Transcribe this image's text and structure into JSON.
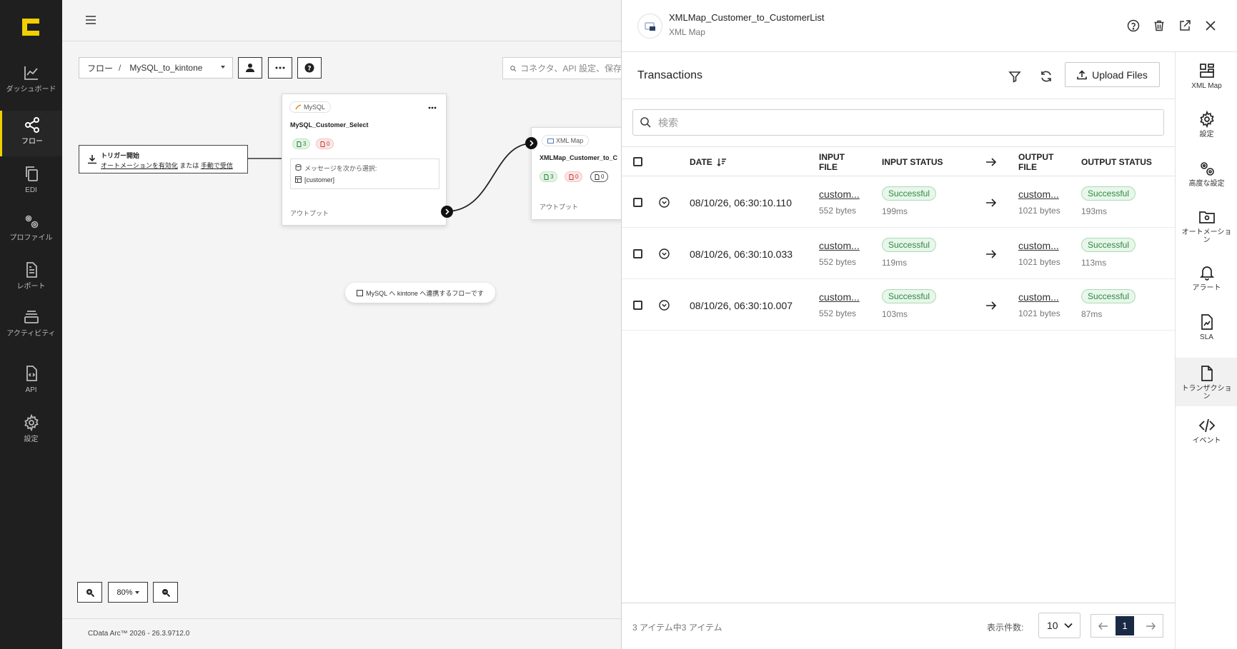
{
  "nav": {
    "items": [
      {
        "label": "ダッシュボード",
        "icon": "chart-line-icon"
      },
      {
        "label": "フロー",
        "icon": "share-nodes-icon",
        "active": true
      },
      {
        "label": "EDI",
        "icon": "copy-icon"
      },
      {
        "label": "プロファイル",
        "icon": "gears-icon"
      },
      {
        "label": "レポート",
        "icon": "file-text-icon"
      },
      {
        "label": "アクティビティ",
        "icon": "layers-icon"
      },
      {
        "label": "API",
        "icon": "file-code-icon"
      },
      {
        "label": "設定",
        "icon": "gear-icon"
      }
    ]
  },
  "canvas": {
    "breadcrumb_root": "フロー",
    "breadcrumb_sep": "/",
    "breadcrumb_flow": "MySQL_to_kintone",
    "search_placeholder": "コネクタ、API 設定、保存",
    "trigger": {
      "title": "トリガー開始",
      "link1": "オートメーションを有効化",
      "connector": "または",
      "link2": "手動で受信"
    },
    "mysql_node": {
      "type": "MySQL",
      "title": "MySQL_Customer_Select",
      "success_count": "3",
      "error_count": "0",
      "message_label": "メッセージを次から選択:",
      "message_value": "[customer]",
      "output_label": "アウトプット"
    },
    "xml_node": {
      "type": "XML Map",
      "title": "XMLMap_Customer_to_C",
      "success_count": "3",
      "error_count": "0",
      "pending_count": "0",
      "output_label": "アウトプット"
    },
    "note": "MySQL へ kintone へ連携するフローです",
    "zoom_level": "80%",
    "footer": "CData Arc™ 2026 - 26.3.9712.0"
  },
  "panel": {
    "title": "XMLMap_Customer_to_CustomerList",
    "subtitle": "XML Map",
    "section_title": "Transactions",
    "upload_label": "Upload Files",
    "search_placeholder": "検索",
    "columns": {
      "date": "DATE",
      "input_file": "INPUT FILE",
      "input_status": "INPUT STATUS",
      "output_file": "OUTPUT FILE",
      "output_status": "OUTPUT STATUS"
    },
    "rows": [
      {
        "date": "08/10/26, 06:30:10.110",
        "input_file": "custom...",
        "input_size": "552 bytes",
        "input_status": "Successful",
        "input_ms": "199ms",
        "output_file": "custom...",
        "output_size": "1021 bytes",
        "output_status": "Successful",
        "output_ms": "193ms"
      },
      {
        "date": "08/10/26, 06:30:10.033",
        "input_file": "custom...",
        "input_size": "552 bytes",
        "input_status": "Successful",
        "input_ms": "119ms",
        "output_file": "custom...",
        "output_size": "1021 bytes",
        "output_status": "Successful",
        "output_ms": "113ms"
      },
      {
        "date": "08/10/26, 06:30:10.007",
        "input_file": "custom...",
        "input_size": "552 bytes",
        "input_status": "Successful",
        "input_ms": "103ms",
        "output_file": "custom...",
        "output_size": "1021 bytes",
        "output_status": "Successful",
        "output_ms": "87ms"
      }
    ],
    "item_count": "3 アイテム中3 アイテム",
    "per_page_label": "表示件数:",
    "per_page_value": "10",
    "current_page": "1"
  },
  "rail": {
    "items": [
      {
        "label": "XML Map",
        "icon": "grid-layout-icon"
      },
      {
        "label": "設定",
        "icon": "gear-icon"
      },
      {
        "label": "高度な設定",
        "icon": "gears-icon"
      },
      {
        "label": "オートメーション",
        "icon": "folder-gear-icon"
      },
      {
        "label": "アラート",
        "icon": "bell-icon"
      },
      {
        "label": "SLA",
        "icon": "file-chart-icon"
      },
      {
        "label": "トランザクション",
        "icon": "file-icon",
        "active": true
      },
      {
        "label": "イベント",
        "icon": "code-icon"
      }
    ]
  },
  "colors": {
    "nav_bg": "#1f1f1f",
    "brand_yellow": "#f0d000",
    "success_green": "#2f8a3f",
    "pager_active": "#1a2a44"
  }
}
